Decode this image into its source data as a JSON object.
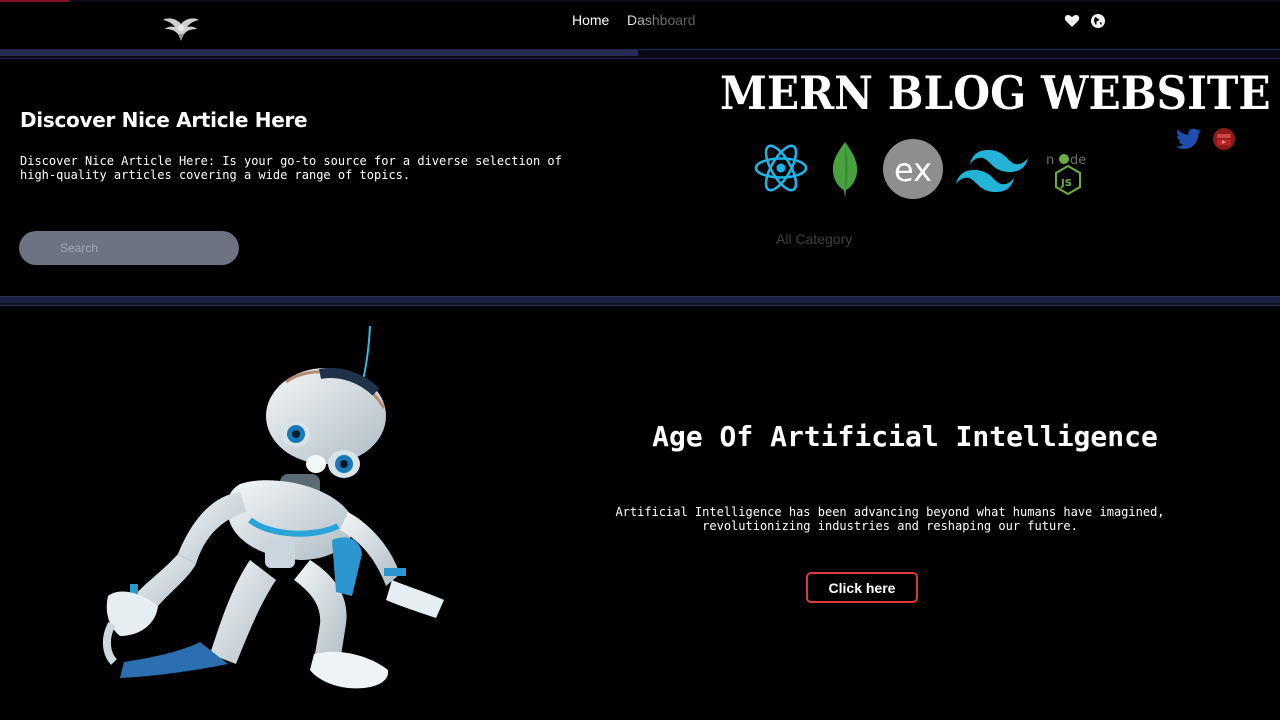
{
  "nav": {
    "logo_icon": "eagle-logo-icon",
    "links": [
      {
        "label": "Home"
      },
      {
        "label": "Dashboard"
      }
    ],
    "icons": [
      "heart-icon",
      "globe-icon"
    ]
  },
  "hero": {
    "title": "Discover Nice Article Here",
    "description": "Discover Nice Article Here: Is your go-to source for a diverse selection of high-quality articles covering a wide range of topics.",
    "search": {
      "placeholder": "Search",
      "value": ""
    }
  },
  "banner": {
    "title": "MERN BLOG WEBSITE",
    "tech_icons": [
      "react-icon",
      "mongodb-icon",
      "express-icon",
      "tailwind-icon",
      "nodejs-icon"
    ],
    "social_icons": [
      "twitter-icon",
      "youtube-icon"
    ]
  },
  "category": {
    "label": "All Category"
  },
  "feature": {
    "image": "robot-illustration",
    "title": "Age Of Artificial Intelligence",
    "description": "Artificial Intelligence has been advancing beyond what humans have imagined, revolutionizing industries and reshaping our future.",
    "button_label": "Click here"
  },
  "colors": {
    "background": "#000000",
    "accent_border": "#d93b3b",
    "search_bg": "#6e7384",
    "divider": "#252b52"
  }
}
